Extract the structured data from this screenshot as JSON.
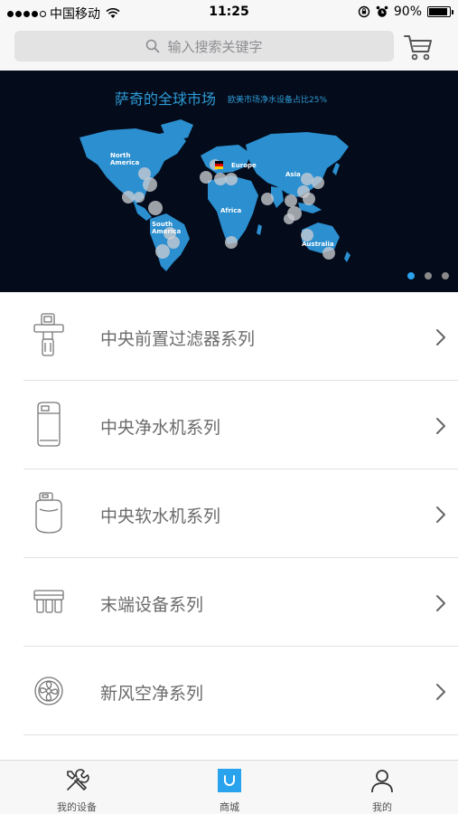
{
  "status_bar": {
    "carrier": "中国移动",
    "time": "11:25",
    "battery": "90%",
    "battery_level": 0.9
  },
  "search": {
    "placeholder": "输入搜索关键字"
  },
  "banner": {
    "title": "萨奇的全球市场",
    "subtitle": "欧美市场净水设备占比25%",
    "regions": {
      "north_america": "North America",
      "europe": "Europe",
      "asia": "Asia",
      "africa": "Africa",
      "south_america": "South America",
      "australia": "Australia"
    },
    "page_count": 3,
    "active_page": 1
  },
  "categories": [
    {
      "label": "中央前置过滤器系列",
      "icon": "pre-filter-icon"
    },
    {
      "label": "中央净水机系列",
      "icon": "water-purifier-icon"
    },
    {
      "label": "中央软水机系列",
      "icon": "water-softener-icon"
    },
    {
      "label": "末端设备系列",
      "icon": "terminal-device-icon"
    },
    {
      "label": "新风空净系列",
      "icon": "fresh-air-icon"
    }
  ],
  "tabs": [
    {
      "label": "我的设备",
      "icon": "tools-icon"
    },
    {
      "label": "商城",
      "icon": "store-icon"
    },
    {
      "label": "我的",
      "icon": "user-icon"
    }
  ],
  "colors": {
    "accent": "#2aa3ef",
    "banner_bg": "#040b1a",
    "map_land": "#2b8fd0"
  }
}
